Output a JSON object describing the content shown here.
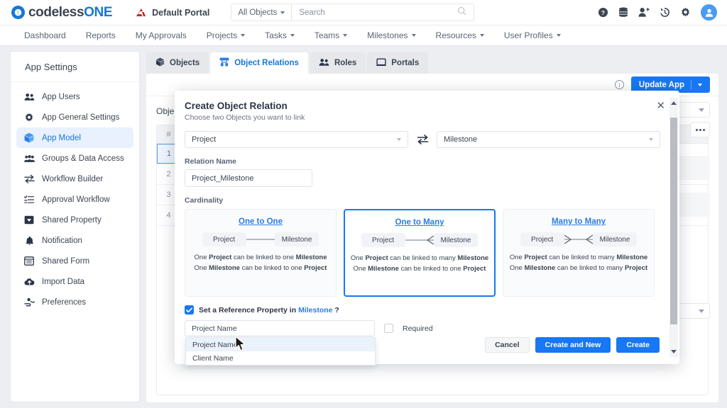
{
  "topbar": {
    "logo_mark": "circle-logo-icon",
    "logo_text_a": "codeless",
    "logo_text_b": "ONE",
    "portal_label": "Default Portal",
    "portal_icon": "red-arrow-icon",
    "object_selector": "All Objects",
    "search_placeholder": "Search",
    "search_value": "",
    "icons": [
      "help-icon",
      "database-icon",
      "add-user-icon",
      "history-icon",
      "gear-icon",
      "user-avatar-icon"
    ]
  },
  "nav": {
    "items": [
      {
        "label": "Dashboard",
        "caret": false
      },
      {
        "label": "Reports",
        "caret": false
      },
      {
        "label": "My Approvals",
        "caret": false
      },
      {
        "label": "Projects",
        "caret": true
      },
      {
        "label": "Tasks",
        "caret": true
      },
      {
        "label": "Teams",
        "caret": true
      },
      {
        "label": "Milestones",
        "caret": true
      },
      {
        "label": "Resources",
        "caret": true
      },
      {
        "label": "User Profiles",
        "caret": true
      }
    ]
  },
  "sidebar": {
    "title": "App Settings",
    "items": [
      {
        "label": "App Users",
        "icon": "users-icon",
        "active": false
      },
      {
        "label": "App General Settings",
        "icon": "gear-icon",
        "active": false
      },
      {
        "label": "App Model",
        "icon": "cube-icon",
        "active": true
      },
      {
        "label": "Groups & Data Access",
        "icon": "group-icon",
        "active": false
      },
      {
        "label": "Workflow Builder",
        "icon": "exchange-icon",
        "active": false
      },
      {
        "label": "Approval Workflow",
        "icon": "checklist-icon",
        "active": false
      },
      {
        "label": "Shared Property",
        "icon": "tag-icon",
        "active": false
      },
      {
        "label": "Notification",
        "icon": "bell-icon",
        "active": false
      },
      {
        "label": "Shared Form",
        "icon": "form-icon",
        "active": false
      },
      {
        "label": "Import Data",
        "icon": "cloud-upload-icon",
        "active": false
      },
      {
        "label": "Preferences",
        "icon": "preferences-icon",
        "active": false
      }
    ]
  },
  "main": {
    "tabs": [
      {
        "label": "Objects",
        "icon": "cube-icon",
        "active": false
      },
      {
        "label": "Object Relations",
        "icon": "relations-icon",
        "active": true
      },
      {
        "label": "Roles",
        "icon": "people-icon",
        "active": false
      },
      {
        "label": "Portals",
        "icon": "window-icon",
        "active": false
      }
    ],
    "info_icon": "info-icon",
    "update_app_label": "Update App",
    "background_label": "Objec",
    "grid_header": "#",
    "grid_rows": [
      "1",
      "2",
      "3",
      "4"
    ]
  },
  "modal": {
    "title": "Create Object Relation",
    "subtitle": "Choose two Objects you want to link",
    "close_icon": "close-icon",
    "swap_icon": "swap-icon",
    "source_object": "Project",
    "target_object": "Milestone",
    "relation_name_label": "Relation Name",
    "relation_name_value": "Project_Milestone",
    "cardinality_label": "Cardinality",
    "cards": [
      {
        "title": "One to One",
        "left": "Project",
        "right": "Milestone",
        "line1_pre": "One ",
        "line1_a": "Project",
        "line1_mid": " can be linked to one ",
        "line1_b": "Milestone",
        "line2_pre": "One ",
        "line2_a": "Milestone",
        "line2_mid": " can be linked to one ",
        "line2_b": "Project",
        "selected": false,
        "marker": "one-to-one"
      },
      {
        "title": "One to Many",
        "left": "Project",
        "right": "Milestone",
        "line1_pre": "One ",
        "line1_a": "Project",
        "line1_mid": " can be linked to many ",
        "line1_b": "Milestone",
        "line2_pre": "One ",
        "line2_a": "Milestone",
        "line2_mid": " can be linked to one ",
        "line2_b": "Project",
        "selected": true,
        "marker": "one-to-many"
      },
      {
        "title": "Many to Many",
        "left": "Project",
        "right": "Milestone",
        "line1_pre": "One ",
        "line1_a": "Project",
        "line1_mid": " can be linked to many ",
        "line1_b": "Milestone",
        "line2_pre": "One ",
        "line2_a": "Milestone",
        "line2_mid": " can be linked to many ",
        "line2_b": "Project",
        "selected": false,
        "marker": "many-to-many"
      }
    ],
    "reference_checkbox_checked": true,
    "reference_text_pre": "Set a Reference Property in ",
    "reference_text_link": "Milestone",
    "reference_text_post": " ?",
    "property_value": "Project Name",
    "property_options": [
      {
        "label": "Project Name",
        "highlighted": true
      },
      {
        "label": "Client Name",
        "highlighted": false
      }
    ],
    "required_label": "Required",
    "required_checked": false,
    "buttons": {
      "cancel": "Cancel",
      "create_and_new": "Create and New",
      "create": "Create"
    }
  },
  "colors": {
    "accent": "#1877f2",
    "link": "#2a7de1",
    "text": "#3c4551",
    "muted": "#6b7385",
    "panel_bg": "#eceef1"
  }
}
